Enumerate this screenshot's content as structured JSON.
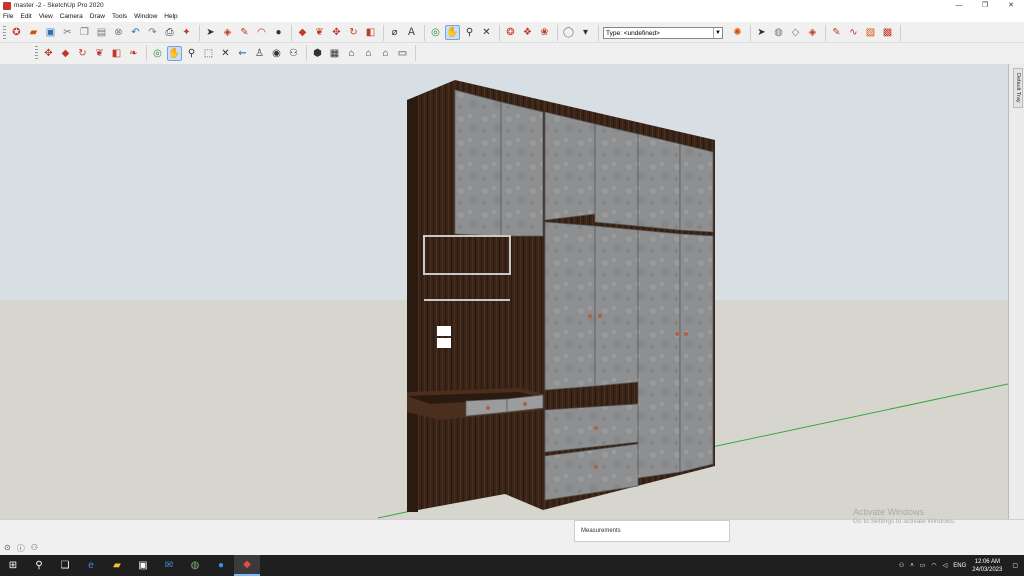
{
  "window": {
    "title": "master -2 - SketchUp Pro 2020",
    "controls": [
      "—",
      "❐",
      "✕"
    ]
  },
  "menu": [
    "File",
    "Edit",
    "View",
    "Camera",
    "Draw",
    "Tools",
    "Window",
    "Help"
  ],
  "toolbar": {
    "type_selector_value": "Type: <undefined>"
  },
  "tray": {
    "label": "Default Tray"
  },
  "statusbar": {
    "measurements_label": "Measurements"
  },
  "watermark": {
    "line1": "Activate Windows",
    "line2": "Go to Settings to activate Windows."
  },
  "taskbar": {
    "language": "ENG",
    "time": "12:06 AM",
    "date": "24/03/2023"
  },
  "colors": {
    "sky": "#d7dee4",
    "ground": "#d6d6ce",
    "wood": "#3a2418",
    "panel": "#8e8f90",
    "accent_active": "#c9defa"
  }
}
